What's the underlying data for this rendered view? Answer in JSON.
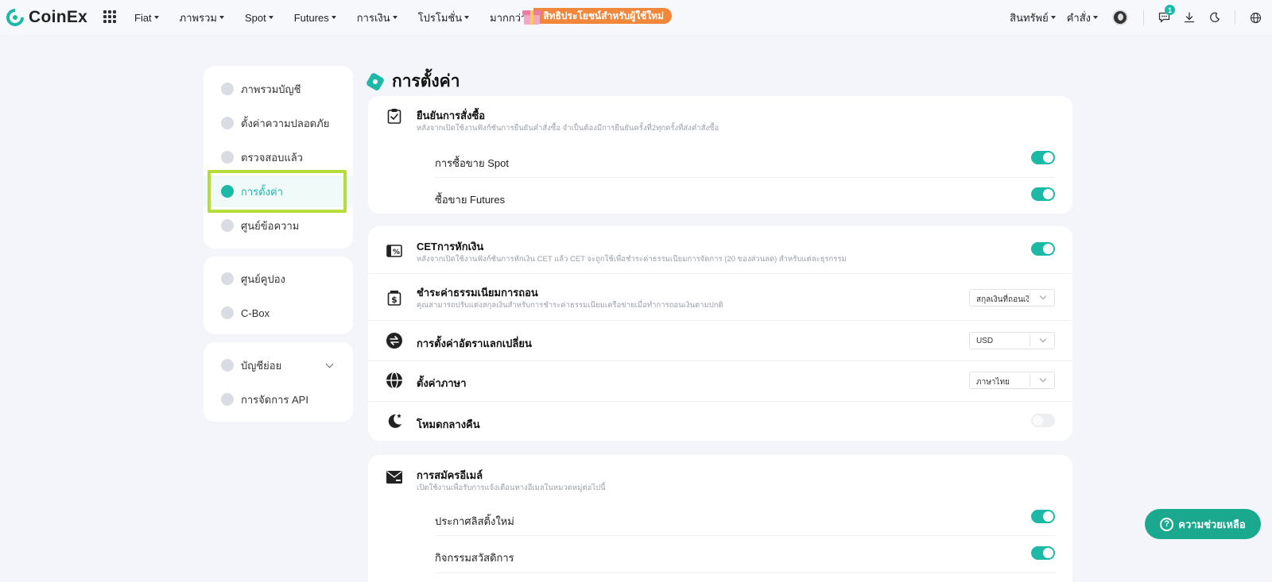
{
  "brand": {
    "name": "CoinEx",
    "accent": "#1db9a7"
  },
  "nav": {
    "items": [
      "Fiat",
      "ภาพรวม",
      "Spot",
      "Futures",
      "การเงิน",
      "โปรโมชั่น",
      "มากกว่า"
    ],
    "promo_label": "สิทธิประโยชน์สำหรับผู้ใช้ใหม่",
    "assets": "สินทรัพย์",
    "orders": "คำสั่ง",
    "messages_badge": "1"
  },
  "sidebar": {
    "group1": [
      "ภาพรวมบัญชี",
      "ตั้งค่าความปลอดภัย",
      "ตรวจสอบแล้ว",
      "การตั้งค่า",
      "ศูนย์ข้อความ"
    ],
    "group2": [
      "ศูนย์คูปอง",
      "C-Box"
    ],
    "group3": [
      "บัญชีย่อย",
      "การจัดการ API"
    ],
    "active": "การตั้งค่า"
  },
  "page": {
    "title": "การตั้งค่า"
  },
  "order_confirm": {
    "title": "ยืนยันการสั่งซื้อ",
    "desc": "หลังจากเปิดใช้งานฟังก์ชันการยืนยันคำสั่งซื้อ จำเป็นต้องมีการยืนยันครั้งที่2ทุกครั้งที่ส่งคำสั่งซื้อ",
    "spot_label": "การซื้อขาย Spot",
    "spot_on": true,
    "futures_label": "ซื้อขาย Futures",
    "futures_on": true
  },
  "prefs": {
    "cet": {
      "title": "CETการหักเงิน",
      "desc": "หลังจากเปิดใช้งานฟังก์ชันการหักเงิน CET แล้ว CET จะถูกใช้เพื่อชำระค่าธรรมเนียมการจัดการ (20 ของส่วนลด) สำหรับแต่ละธุรกรรม",
      "on": true
    },
    "withdraw_fee": {
      "title": "ชำระค่าธรรมเนียมการถอน",
      "desc": "คุณสามารถปรับแต่งสกุลเงินสำหรับการชำระค่าธรรมเนียมเครือข่ายเมื่อทำการถอนเงินตามปกติ",
      "value": "สกุลเงินที่ถอนเงิน"
    },
    "exchange_rate": {
      "title": "การตั้งค่าอัตราแลกเปลี่ยน",
      "value": "USD"
    },
    "language": {
      "title": "ตั้งค่าภาษา",
      "value": "ภาษาไทย"
    },
    "night_mode": {
      "title": "โหมดกลางคืน",
      "on": false
    }
  },
  "email_sub": {
    "title": "การสมัครอีเมล์",
    "desc": "เปิดใช้งานเพื่อรับการแจ้งเตือนทางอีเมลในหมวดหมู่ต่อไปนี้",
    "item1_label": "ประกาศลิสติ้งใหม่",
    "item1_on": true,
    "item2_label": "กิจกรรมสวัสดิการ",
    "item2_on": true
  },
  "help": {
    "label": "ความช่วยเหลือ",
    "icon_glyph": "?"
  }
}
